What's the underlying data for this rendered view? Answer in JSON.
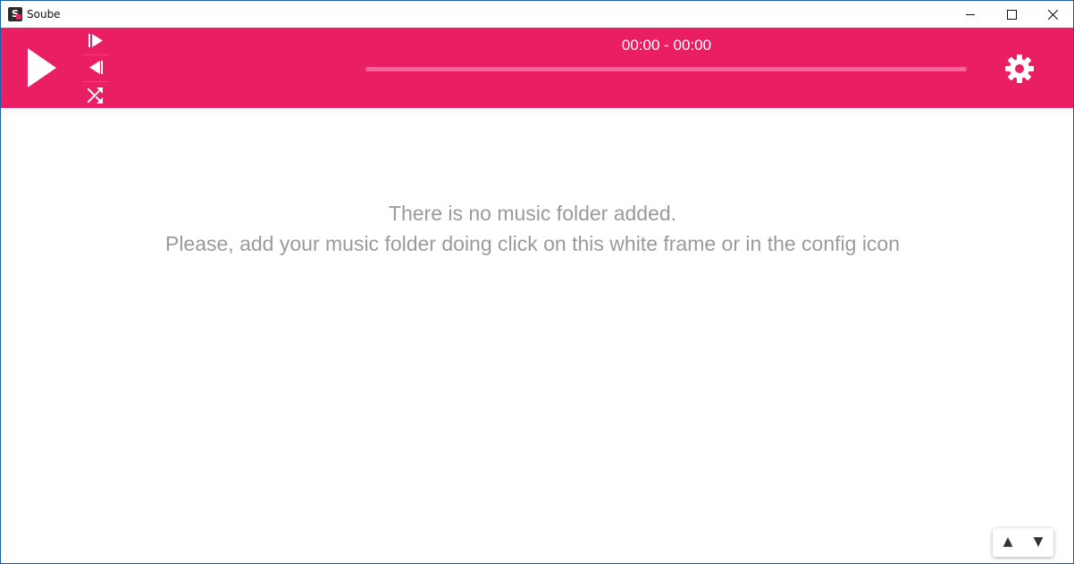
{
  "window": {
    "title": "Soube",
    "icon_letter": "S"
  },
  "player": {
    "time": "00:00 - 00:00",
    "progress": 0,
    "accent_color": "#e91e63",
    "icons": {
      "play": "play-icon",
      "next": "next-icon",
      "prev": "previous-icon",
      "shuffle": "shuffle-icon",
      "settings": "gear-icon"
    }
  },
  "content": {
    "line1": "There is no music folder added.",
    "line2": "Please, add your music folder doing click on this white frame or in the config icon"
  },
  "scroll": {
    "up_label": "▲",
    "down_label": "▼"
  }
}
